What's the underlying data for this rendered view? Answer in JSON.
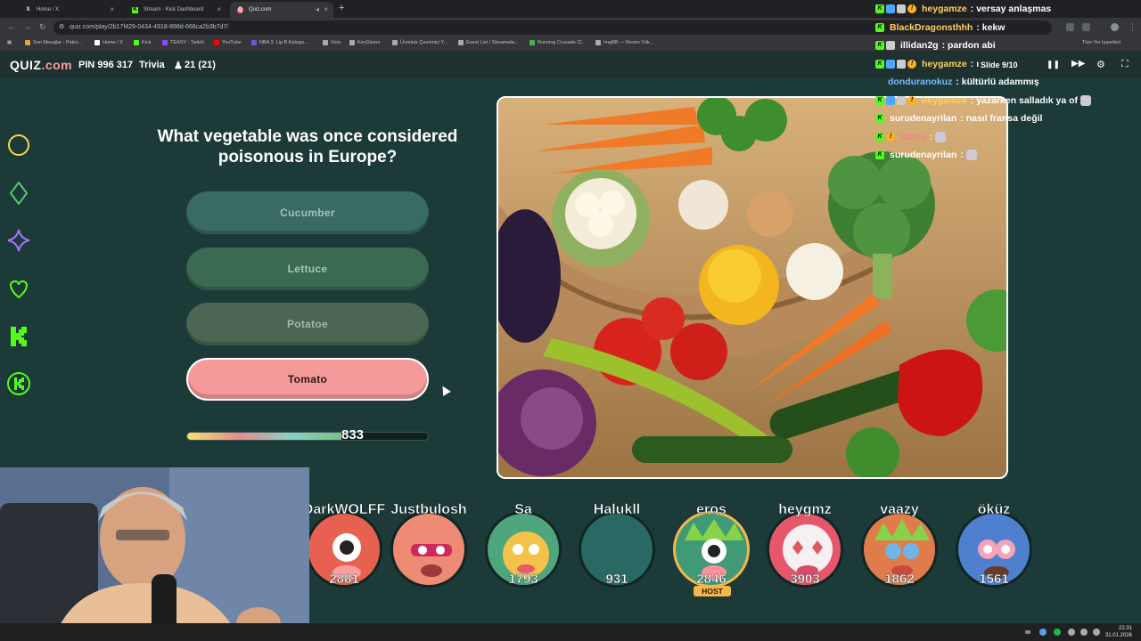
{
  "browser": {
    "tabs": [
      {
        "label": "Home / X",
        "icon": "x-logo-icon",
        "active": false
      },
      {
        "label": "Stream - Kick Dashboard",
        "icon": "kick-logo-icon",
        "active": false
      },
      {
        "label": "Quiz.com",
        "icon": "quiz-logo-icon",
        "active": true
      }
    ],
    "url": "quiz.com/play/2b17f429-0434-4918-898d-668ca2b3b7d7/",
    "bookmarks": [
      "Son Mesajlar - Patici...",
      "Home / X",
      "Kick",
      "TEASY - Twitch",
      "YouTube",
      "NBA 3. Lig B Katego...",
      "Vorp",
      "KeyGivers",
      "Ücretsiz Çevrimiçi Y...",
      "Event List / Streamela...",
      "Running Crusade Cl...",
      "ImgBB — Resim Yük..."
    ],
    "all_bookmarks_label": "Tüm Yer İşaretleri"
  },
  "quiz": {
    "logo_text": "QUIZ",
    "logo_suffix": ".com",
    "pin": "PIN 996 317",
    "mode": "Trivia",
    "players": "21 (21)",
    "question": "What vegetable was once considered poisonous in Europe?",
    "answers": [
      {
        "label": "Cucumber",
        "state": "dim"
      },
      {
        "label": "Lettuce",
        "state": "dim"
      },
      {
        "label": "Potatoe",
        "state": "dim"
      },
      {
        "label": "Tomato",
        "state": "correct"
      }
    ],
    "score": "833",
    "progress_fraction": 0.64,
    "slide": "Slide 9/10"
  },
  "leaderboard": [
    {
      "name": "DarkWOLFF",
      "score": "2881",
      "avatar_color": "#e8604f",
      "host": false
    },
    {
      "name": "Justbulosh",
      "score": "",
      "avatar_color": "#ee8b74",
      "host": false
    },
    {
      "name": "Sa",
      "score": "1793",
      "avatar_color": "#4fa57c",
      "host": false
    },
    {
      "name": "Halukll",
      "score": "931",
      "avatar_color": "#2a6963",
      "host": false
    },
    {
      "name": "eros",
      "score": "2846",
      "avatar_color": "#3f9a75",
      "host": true,
      "host_label": "HOST"
    },
    {
      "name": "heygmz",
      "score": "3903",
      "avatar_color": "#e7576b",
      "host": false
    },
    {
      "name": "vaazy",
      "score": "1862",
      "avatar_color": "#e07c4b",
      "host": false
    },
    {
      "name": "öküz",
      "score": "1561",
      "avatar_color": "#4f7fcf",
      "host": false
    }
  ],
  "chat": [
    {
      "user": "heygamze",
      "color": "#ffd15e",
      "message": ": versay anlaşmas",
      "badges": [
        "#53fc18",
        "#4aa8ff",
        "#cccccc",
        "#ffb020"
      ]
    },
    {
      "user": "BlackDragonsthhh",
      "color": "#ffd15e",
      "message": ": kekw",
      "badges": [
        "#53fc18"
      ]
    },
    {
      "user": "illidan2g",
      "color": "#ffffff",
      "message": ": pardon abi",
      "badges": [
        "#53fc18",
        "#cccccc"
      ]
    },
    {
      "user": "heygamze",
      "color": "#ffd15e",
      "message": ": ı",
      "badges": [
        "#53fc18",
        "#4aa8ff",
        "#cccccc",
        "#ffb020"
      ]
    },
    {
      "user": "donduranokuz",
      "color": "#7fb6ff",
      "message": ": kültürlü adammış",
      "badges": []
    },
    {
      "user": "heygamze",
      "color": "#ffd15e",
      "message": ": yazarken salladık ya of",
      "badges": [
        "#53fc18",
        "#4aa8ff",
        "#cccccc",
        "#ffb020"
      ],
      "emote": true
    },
    {
      "user": "surudenayrilan",
      "color": "#ffffff",
      "message": ": nasıl fransa değil",
      "badges": [
        "#53fc18"
      ]
    },
    {
      "user": "tabris",
      "color": "#ff7a9a",
      "message": ":",
      "badges": [
        "#53fc18",
        "#ffb020"
      ],
      "emote": true
    },
    {
      "user": "surudenayrilan",
      "color": "#ffffff",
      "message": ":",
      "badges": [
        "#53fc18"
      ],
      "emote": true
    }
  ],
  "taskbar": {
    "time": "22:31",
    "date": "31.01.2026"
  }
}
